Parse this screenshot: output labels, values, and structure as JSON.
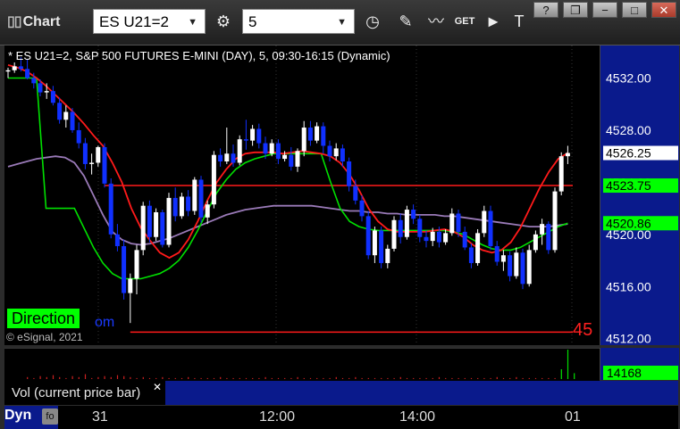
{
  "toolbar": {
    "title": "Chart",
    "symbol_value": "ES U21=2",
    "interval_value": "5",
    "icons": [
      "gear-icon",
      "clock-icon",
      "pencil-icon",
      "study-icon",
      "get-icon",
      "play-icon",
      "text-tool-icon"
    ],
    "window_buttons": [
      "?",
      "❐",
      "−",
      "□",
      "✕"
    ]
  },
  "header": {
    "text": "* ES U21=2, S&P 500 FUTURES E-MINI (DAY), 5, 09:30-16:15 (Dynamic)"
  },
  "overlay": {
    "direction_label": "Direction",
    "direction_tail": "om",
    "copyright": "© eSignal, 2021",
    "right_number": "45"
  },
  "volume": {
    "label": "Vol (current price bar)",
    "value": "14168",
    "close_symbol": "✕"
  },
  "bottom": {
    "dyn_label": "Dyn",
    "x_ticks": [
      "31",
      "12:00",
      "14:00",
      "01"
    ]
  },
  "colors": {
    "up_candle": "#ffffff",
    "down_candle": "#1030ff",
    "red_line": "#ff1a1a",
    "green_line": "#00e000",
    "purple_line": "#9a7ab8",
    "axis_bg": "#0a1a8c"
  },
  "chart_data": {
    "type": "candlestick",
    "title": "ES U21=2, S&P 500 FUTURES E-MINI (DAY), 5, 09:30-16:15 (Dynamic)",
    "y_ticks": [
      4532.0,
      4528.0,
      4524.0,
      4520.0,
      4516.0,
      4512.0
    ],
    "ylim": [
      4511.5,
      4534.5
    ],
    "price_labels": [
      {
        "label": "4526.25",
        "value": 4526.25,
        "kind": "last"
      },
      {
        "label": "4523.75",
        "value": 4523.75,
        "kind": "green"
      },
      {
        "label": "4520.86",
        "value": 4520.86,
        "kind": "green"
      }
    ],
    "levels": [
      {
        "value": 4523.75,
        "color": "red",
        "from_bar": 15
      },
      {
        "value": 4512.5,
        "color": "red",
        "from_bar": 19
      }
    ],
    "bars": [
      [
        4532.5,
        4532.8,
        4532.0,
        4532.6
      ],
      [
        4532.6,
        4533.2,
        4532.4,
        4532.9
      ],
      [
        4532.9,
        4533.6,
        4532.5,
        4532.7
      ],
      [
        4532.7,
        4533.4,
        4531.9,
        4532.0
      ],
      [
        4532.0,
        4532.4,
        4531.2,
        4531.6
      ],
      [
        4531.6,
        4531.9,
        4530.6,
        4530.9
      ],
      [
        4530.9,
        4531.6,
        4530.4,
        4531.0
      ],
      [
        4531.0,
        4531.4,
        4529.9,
        4530.1
      ],
      [
        4530.1,
        4530.5,
        4528.5,
        4528.8
      ],
      [
        4528.8,
        4529.9,
        4528.2,
        4529.4
      ],
      [
        4529.4,
        4529.7,
        4527.8,
        4528.0
      ],
      [
        4528.0,
        4528.6,
        4526.6,
        4527.0
      ],
      [
        4527.0,
        4527.4,
        4525.0,
        4525.4
      ],
      [
        4525.4,
        4526.2,
        4524.6,
        4525.5
      ],
      [
        4525.5,
        4526.8,
        4525.2,
        4526.7
      ],
      [
        4526.7,
        4527.0,
        4523.6,
        4523.9
      ],
      [
        4523.9,
        4524.3,
        4519.7,
        4520.0
      ],
      [
        4520.0,
        4520.8,
        4518.7,
        4519.1
      ],
      [
        4519.1,
        4519.6,
        4515.0,
        4515.5
      ],
      [
        4515.5,
        4517.0,
        4513.2,
        4516.6
      ],
      [
        4516.6,
        4519.2,
        4515.4,
        4518.8
      ],
      [
        4518.8,
        4522.5,
        4518.4,
        4522.2
      ],
      [
        4522.2,
        4522.6,
        4519.4,
        4519.8
      ],
      [
        4519.8,
        4522.0,
        4519.5,
        4521.7
      ],
      [
        4521.7,
        4521.9,
        4519.0,
        4519.2
      ],
      [
        4519.2,
        4523.2,
        4519.0,
        4522.8
      ],
      [
        4522.8,
        4523.6,
        4521.0,
        4521.4
      ],
      [
        4521.4,
        4523.2,
        4521.2,
        4522.9
      ],
      [
        4522.9,
        4523.4,
        4521.4,
        4521.8
      ],
      [
        4521.8,
        4524.4,
        4521.5,
        4524.2
      ],
      [
        4524.2,
        4524.5,
        4520.9,
        4521.3
      ],
      [
        4521.3,
        4522.6,
        4520.8,
        4522.3
      ],
      [
        4522.3,
        4526.4,
        4522.0,
        4526.1
      ],
      [
        4526.1,
        4526.6,
        4525.2,
        4525.6
      ],
      [
        4525.6,
        4528.2,
        4525.4,
        4526.2
      ],
      [
        4526.2,
        4526.9,
        4525.2,
        4525.5
      ],
      [
        4525.5,
        4527.6,
        4525.3,
        4527.3
      ],
      [
        4527.3,
        4528.8,
        4526.5,
        4527.2
      ],
      [
        4527.2,
        4528.4,
        4526.8,
        4528.1
      ],
      [
        4528.1,
        4528.5,
        4526.6,
        4527.0
      ],
      [
        4527.0,
        4527.5,
        4525.8,
        4526.2
      ],
      [
        4526.2,
        4527.3,
        4526.0,
        4527.0
      ],
      [
        4527.0,
        4527.3,
        4525.4,
        4525.8
      ],
      [
        4525.8,
        4526.4,
        4525.6,
        4526.1
      ],
      [
        4526.1,
        4526.7,
        4524.9,
        4525.2
      ],
      [
        4525.2,
        4526.6,
        4524.8,
        4526.4
      ],
      [
        4526.4,
        4528.7,
        4526.0,
        4528.2
      ],
      [
        4528.2,
        4528.7,
        4526.8,
        4527.2
      ],
      [
        4527.2,
        4528.6,
        4527.0,
        4528.3
      ],
      [
        4528.3,
        4528.6,
        4526.2,
        4526.8
      ],
      [
        4526.8,
        4527.2,
        4525.6,
        4526.0
      ],
      [
        4526.0,
        4527.0,
        4525.7,
        4526.6
      ],
      [
        4526.6,
        4526.9,
        4525.2,
        4525.6
      ],
      [
        4525.6,
        4525.9,
        4523.3,
        4523.7
      ],
      [
        4523.7,
        4524.2,
        4522.3,
        4522.6
      ],
      [
        4522.6,
        4523.0,
        4521.0,
        4521.4
      ],
      [
        4521.4,
        4521.8,
        4518.1,
        4518.4
      ],
      [
        4518.4,
        4520.6,
        4517.8,
        4520.3
      ],
      [
        4520.3,
        4520.6,
        4517.4,
        4517.8
      ],
      [
        4517.8,
        4519.2,
        4517.4,
        4518.9
      ],
      [
        4518.9,
        4521.4,
        4518.7,
        4521.1
      ],
      [
        4521.1,
        4521.6,
        4519.3,
        4519.8
      ],
      [
        4519.8,
        4522.2,
        4519.6,
        4521.9
      ],
      [
        4521.9,
        4522.3,
        4520.8,
        4521.2
      ],
      [
        4521.2,
        4521.5,
        4519.4,
        4519.8
      ],
      [
        4519.8,
        4520.3,
        4519.0,
        4519.5
      ],
      [
        4519.5,
        4520.5,
        4519.1,
        4520.2
      ],
      [
        4520.2,
        4520.6,
        4519.0,
        4519.4
      ],
      [
        4519.4,
        4520.4,
        4519.2,
        4520.1
      ],
      [
        4520.1,
        4522.0,
        4519.9,
        4521.6
      ],
      [
        4521.6,
        4521.9,
        4519.8,
        4520.2
      ],
      [
        4520.2,
        4520.6,
        4518.8,
        4519.0
      ],
      [
        4519.0,
        4519.3,
        4517.4,
        4517.8
      ],
      [
        4517.8,
        4520.4,
        4517.6,
        4520.1
      ],
      [
        4520.1,
        4522.2,
        4519.8,
        4521.8
      ],
      [
        4521.8,
        4522.2,
        4518.8,
        4519.1
      ],
      [
        4519.1,
        4519.5,
        4517.6,
        4517.9
      ],
      [
        4517.9,
        4518.8,
        4517.2,
        4518.4
      ],
      [
        4518.4,
        4518.7,
        4516.4,
        4516.8
      ],
      [
        4516.8,
        4519.0,
        4516.6,
        4518.6
      ],
      [
        4518.6,
        4518.9,
        4515.8,
        4516.2
      ],
      [
        4516.2,
        4519.2,
        4516.0,
        4518.8
      ],
      [
        4518.8,
        4520.3,
        4518.6,
        4520.0
      ],
      [
        4520.0,
        4521.2,
        4519.2,
        4520.8
      ],
      [
        4520.8,
        4521.0,
        4518.5,
        4518.8
      ],
      [
        4518.8,
        4523.6,
        4518.6,
        4523.3
      ],
      [
        4523.3,
        4526.3,
        4523.0,
        4526.0
      ],
      [
        4526.0,
        4526.8,
        4525.4,
        4526.25
      ]
    ],
    "red_line": [
      4533.0,
      4532.8,
      4532.5,
      4532.0,
      4531.4,
      4530.7,
      4530.0,
      4529.3,
      4528.5,
      4527.6,
      4526.8,
      4525.5,
      4524.0,
      4522.0,
      4520.5,
      4519.5,
      4518.6,
      4518.2,
      4518.6,
      4519.6,
      4521.0,
      4522.6,
      4524.0,
      4525.0,
      4525.8,
      4526.2,
      4526.3,
      4526.3,
      4526.3,
      4526.2,
      4526.3,
      4526.4,
      4526.3,
      4526.2,
      4526.0,
      4525.5,
      4524.6,
      4523.4,
      4522.0,
      4521.0,
      4520.4,
      4520.2,
      4520.2,
      4520.2,
      4520.2,
      4520.3,
      4520.4,
      4520.2,
      4519.8,
      4519.2,
      4518.8,
      4518.6,
      4518.8,
      4519.4,
      4520.5,
      4522.0,
      4523.5,
      4524.8,
      4525.8,
      4526.25
    ],
    "green_line": [
      4532.0,
      4532.0,
      4532.0,
      4532.0,
      4522.0,
      4522.0,
      4522.0,
      4522.0,
      4520.5,
      4519.0,
      4517.8,
      4517.0,
      4516.6,
      4516.6,
      4516.6,
      4516.8,
      4517.0,
      4517.4,
      4518.0,
      4519.0,
      4520.3,
      4521.8,
      4523.2,
      4524.2,
      4525.0,
      4525.5,
      4525.8,
      4526.0,
      4526.2,
      4526.2,
      4526.2,
      4526.2,
      4526.2,
      4526.2,
      4524.0,
      4522.0,
      4521.0,
      4520.6,
      4520.4,
      4520.3,
      4520.3,
      4520.3,
      4520.3,
      4520.3,
      4520.3,
      4520.3,
      4520.3,
      4520.2,
      4520.0,
      4519.6,
      4519.2,
      4518.9,
      4518.8,
      4518.8,
      4519.0,
      4519.4,
      4519.8,
      4520.2,
      4520.6,
      4520.86
    ],
    "purple_line": [
      4525.2,
      4525.4,
      4525.6,
      4525.8,
      4525.9,
      4526.0,
      4525.9,
      4525.5,
      4524.5,
      4523.0,
      4521.5,
      4520.2,
      4519.6,
      4519.3,
      4519.2,
      4519.3,
      4519.5,
      4519.7,
      4520.0,
      4520.3,
      4520.6,
      4520.9,
      4521.2,
      4521.5,
      4521.7,
      4521.9,
      4522.0,
      4522.1,
      4522.2,
      4522.2,
      4522.2,
      4522.2,
      4522.2,
      4522.1,
      4522.0,
      4521.9,
      4521.8,
      4521.8,
      4521.7,
      4521.7,
      4521.6,
      4521.6,
      4521.5,
      4521.5,
      4521.5,
      4521.5,
      4521.4,
      4521.4,
      4521.3,
      4521.2,
      4521.1,
      4521.0,
      4520.9,
      4520.8,
      4520.7,
      4520.6,
      4520.6,
      4520.6,
      4520.7,
      4520.8
    ],
    "volume": [
      0,
      0,
      0,
      2,
      1,
      3,
      2,
      4,
      2,
      1,
      3,
      2,
      5,
      1,
      2,
      3,
      2,
      4,
      3,
      2,
      1,
      2,
      1,
      1,
      2,
      1,
      1,
      1,
      2,
      1,
      1,
      1,
      1,
      2,
      1,
      1,
      1,
      1,
      1,
      1,
      2,
      1,
      1,
      1,
      1,
      2,
      1,
      1,
      1,
      1,
      1,
      2,
      1,
      1,
      2,
      1,
      1,
      1,
      1,
      1,
      1,
      2,
      1,
      1,
      1,
      1,
      1,
      2,
      1,
      1,
      1,
      1,
      1,
      1,
      1,
      1,
      2,
      1,
      1,
      2,
      1,
      1,
      1,
      1,
      1,
      1,
      10,
      30,
      6
    ],
    "x_ticks": [
      "31",
      "12:00",
      "14:00",
      "01"
    ]
  }
}
